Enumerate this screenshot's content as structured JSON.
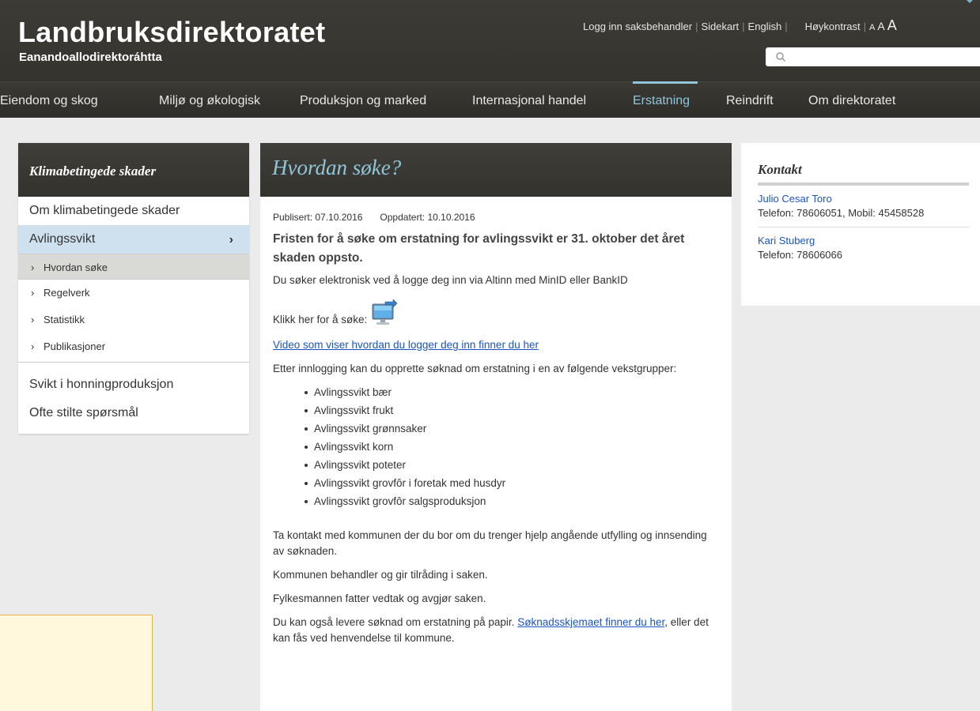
{
  "header": {
    "title": "Landbruksdirektoratet",
    "subtitle": "Eanandoallodirektoráhtta",
    "util_links": {
      "login": "Logg inn saksbehandler",
      "sitemap": "Sidekart",
      "english": "English",
      "contrast": "Høykontrast",
      "font_small": "A",
      "font_medium": "A",
      "font_large": "A"
    },
    "search_placeholder": ""
  },
  "nav": {
    "items": [
      {
        "label": "Eiendom og skog"
      },
      {
        "label": "Miljø og økologisk"
      },
      {
        "label": "Produksjon og marked"
      },
      {
        "label": "Internasjonal handel"
      },
      {
        "label": "Erstatning",
        "active": true
      },
      {
        "label": "Reindrift"
      },
      {
        "label": "Om direktoratet"
      }
    ]
  },
  "sidebar": {
    "heading": "Klimabetingede skader",
    "items": [
      {
        "label": "Om klimabetingede skader"
      },
      {
        "label": "Avlingssvikt",
        "selected": true,
        "chevron": "›"
      },
      {
        "label": "Svikt i honningproduksjon"
      },
      {
        "label": "Ofte stilte spørsmål"
      }
    ],
    "subitems": [
      {
        "label": "Hvordan søke",
        "current": true
      },
      {
        "label": "Regelverk"
      },
      {
        "label": "Statistikk"
      },
      {
        "label": "Publikasjoner"
      }
    ],
    "sub_arrow": "›"
  },
  "article": {
    "title": "Hvordan søke?",
    "published": "Publisert: 07.10.2016",
    "updated": "Oppdatert: 10.10.2016",
    "lead": "Fristen for å søke om erstatning for avlingssvikt er 31. oktober det året skaden oppsto.",
    "p1": "Du søker elektronisk ved å logge deg inn via Altinn med MinID eller BankID",
    "apply_label": "Klikk her for å søke:",
    "video_link": "Video som viser hvordan du logger deg inn finner du her",
    "p2": "Etter innlogging kan du opprette søknad om erstatning i en av følgende vekstgrupper:",
    "list": [
      "Avlingssvikt bær",
      "Avlingssvikt frukt",
      "Avlingssvikt grønnsaker",
      "Avlingssvikt korn",
      "Avlingssvikt poteter",
      "Avlingssvikt grovfôr i foretak med husdyr",
      "Avlingssvikt grovfôr salgsproduksjon"
    ],
    "p3": "Ta kontakt med kommunen der du bor om du trenger hjelp angående utfylling og innsending av søknaden.",
    "p4": "Kommunen behandler og gir tilråding i saken.",
    "p5": "Fylkesmannen fatter vedtak og avgjør saken.",
    "p6_before": "Du kan også levere søknad om erstatning på papir. ",
    "p6_link": "Søknadsskjemaet finner du her",
    "p6_after": ", eller det kan fås ved henvendelse til kommune."
  },
  "contact": {
    "heading": "Kontakt",
    "people": [
      {
        "name": "Julio Cesar Toro",
        "phone": "Telefon: 78606051, Mobil: 45458528"
      },
      {
        "name": "Kari Stuberg",
        "phone": "Telefon: 78606066"
      }
    ]
  },
  "colors": {
    "header_bg": "#3d3b36",
    "accent": "#8fc6da",
    "link": "#1a55c0",
    "selected_bg": "#cfe0ef"
  },
  "icons": {
    "search": "search-icon",
    "apply": "computer-monitor-arrow-icon",
    "chevron": "chevron-right-icon"
  }
}
